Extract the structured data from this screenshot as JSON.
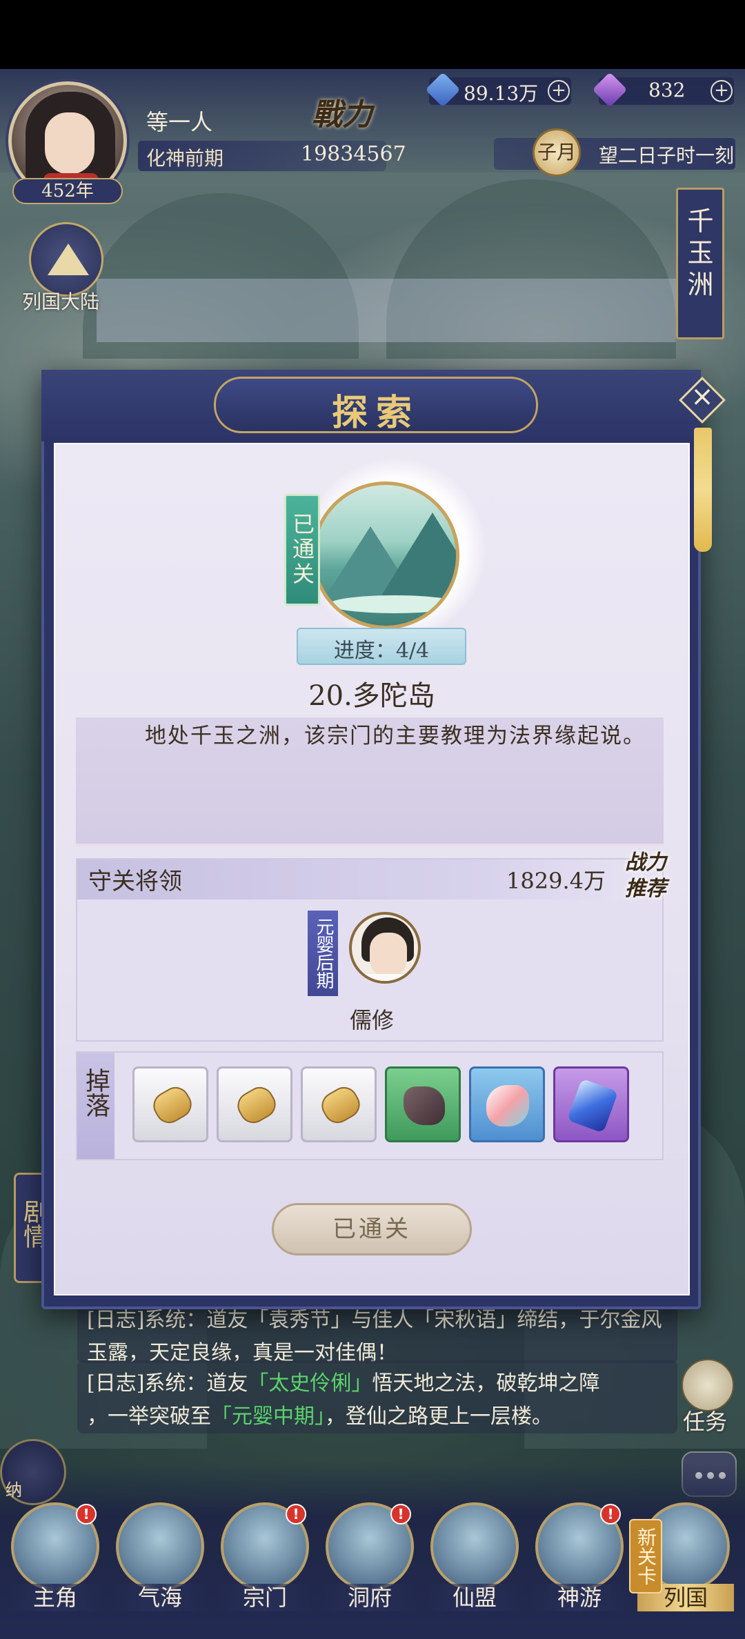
{
  "player": {
    "name": "等一人",
    "realm": "化神前期",
    "age": "452年",
    "power": "19834567"
  },
  "resources": {
    "spirit_stone": "89.13万",
    "gem": "832"
  },
  "calendar": {
    "month": "子月",
    "date": "望二日子时一刻"
  },
  "region": {
    "name": "千玉洲"
  },
  "continent": {
    "label": "列国大陆"
  },
  "side_tabs": {
    "story": "剧情"
  },
  "dialog": {
    "title": "探索",
    "cleared_tag": "已通关",
    "progress": "进度：4/4",
    "progress_value": {
      "done": 4,
      "total": 4
    },
    "location_name": "20.多陀岛",
    "description": "地处千玉之洲，该宗门的主要教理为法界缘起说。",
    "guard": {
      "section_title": "守关将领",
      "power": "1829.4万",
      "recommend_badge": "战力推荐",
      "name": "儒修",
      "realm": "元婴后期"
    },
    "drops": {
      "label": "掉落",
      "items": [
        {
          "icon": "spirit-token-icon",
          "rarity": "common"
        },
        {
          "icon": "spirit-token-icon",
          "rarity": "common"
        },
        {
          "icon": "spirit-token-icon",
          "rarity": "common"
        },
        {
          "icon": "ore-rock-icon",
          "rarity": "green"
        },
        {
          "icon": "rainbow-crystal-icon",
          "rarity": "blue"
        },
        {
          "icon": "blue-crystal-icon",
          "rarity": "purple"
        }
      ]
    },
    "button": "已通关"
  },
  "logs": [
    {
      "line1": "[日志]系统：道友「袁秀节」与佳人「宋秋语」缔结，于尔金风",
      "line2": "玉露，天定良缘，真是一对佳偶！"
    },
    {
      "prefix": "[日志]系统：道友",
      "name": "「太史伶俐」",
      "middle": "悟天地之法，破乾坤之障",
      "line2_prefix": "，一举突破至",
      "realm": "「元婴中期」",
      "line2_suffix": "，登仙之路更上一层楼。"
    }
  ],
  "side_buttons": {
    "task": "任务",
    "shop": "纳"
  },
  "nav": {
    "items": [
      {
        "label": "主角",
        "badge": "!"
      },
      {
        "label": "气海",
        "badge": ""
      },
      {
        "label": "宗门",
        "badge": "!"
      },
      {
        "label": "洞府",
        "badge": "!"
      },
      {
        "label": "仙盟",
        "badge": ""
      },
      {
        "label": "神游",
        "badge": "!"
      },
      {
        "label": "列国",
        "badge": ""
      }
    ],
    "new_tag": "新关卡"
  },
  "colors": {
    "panel": "#2c3466",
    "accent_gold": "#e8c978",
    "highlight_green": "#59d46b",
    "badge_red": "#d8342c"
  }
}
